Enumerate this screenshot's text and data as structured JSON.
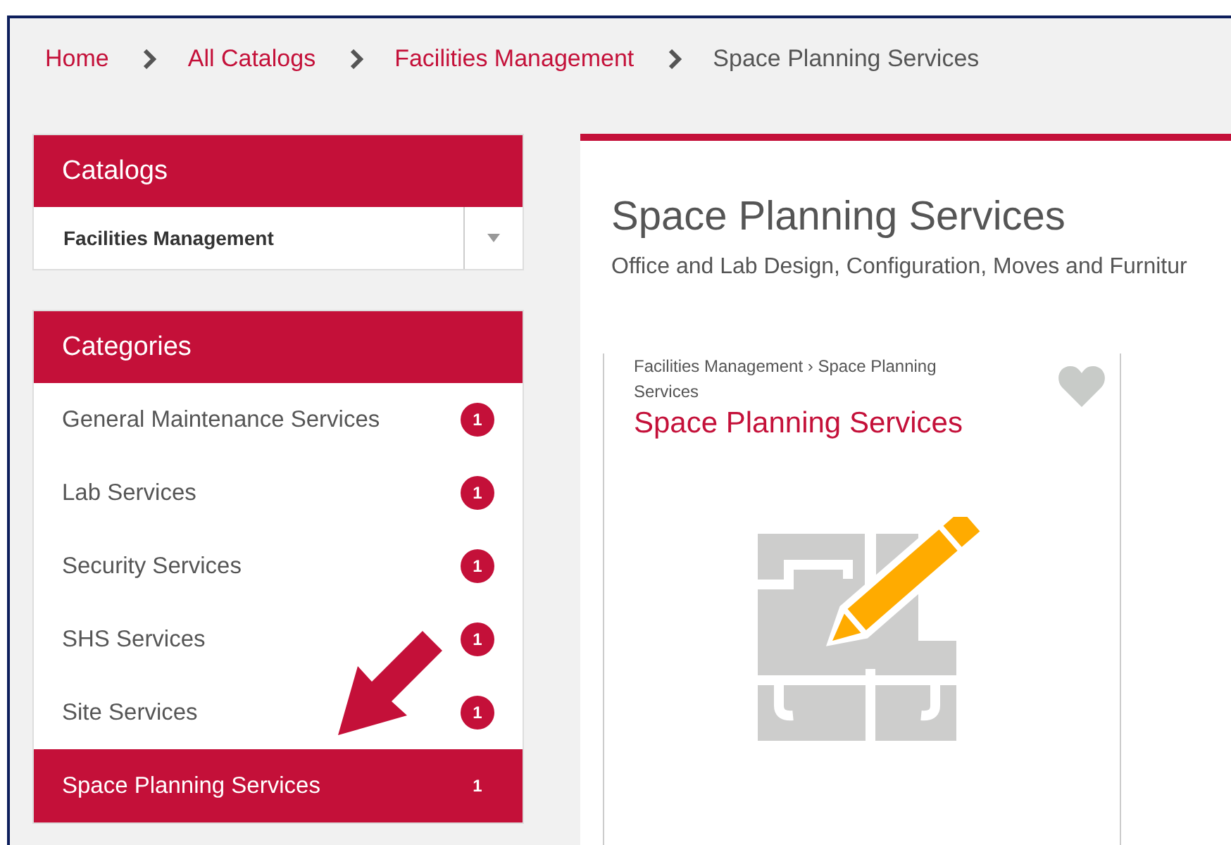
{
  "breadcrumb": [
    {
      "label": "Home",
      "current": false
    },
    {
      "label": "All Catalogs",
      "current": false
    },
    {
      "label": "Facilities Management",
      "current": false
    },
    {
      "label": "Space Planning Services",
      "current": true
    }
  ],
  "catalogs": {
    "title": "Catalogs",
    "value": "Facilities Management"
  },
  "categories": {
    "title": "Categories",
    "items": [
      {
        "label": "General Maintenance Services",
        "count": "1",
        "selected": false
      },
      {
        "label": "Lab Services",
        "count": "1",
        "selected": false
      },
      {
        "label": "Security Services",
        "count": "1",
        "selected": false
      },
      {
        "label": "SHS Services",
        "count": "1",
        "selected": false
      },
      {
        "label": "Site Services",
        "count": "1",
        "selected": false
      },
      {
        "label": "Space Planning Services",
        "count": "1",
        "selected": true
      }
    ]
  },
  "page": {
    "title": "Space Planning Services",
    "description": "Office and Lab Design, Configuration, Moves and Furnitur"
  },
  "card": {
    "path": "Facilities Management › Space Planning Services",
    "title": "Space Planning Services",
    "favorite": false
  }
}
